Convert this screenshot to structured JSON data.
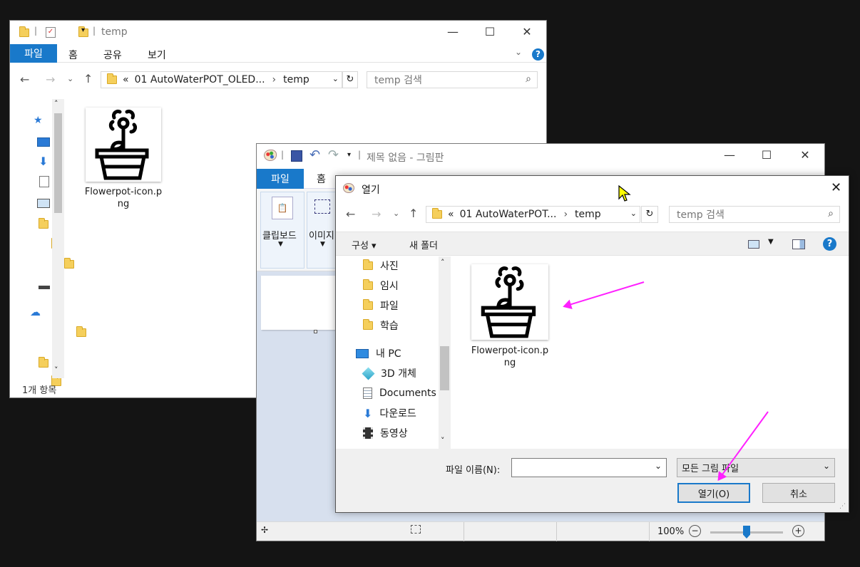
{
  "explorer": {
    "title": "temp",
    "tabs": [
      "파일",
      "홈",
      "공유",
      "보기"
    ],
    "address": {
      "prefix": "«",
      "path1": "01 AutoWaterPOT_OLED...",
      "sep": "›",
      "path2": "temp"
    },
    "search_placeholder": "temp 검색",
    "file": {
      "name_line1": "Flowerpot-icon.p",
      "name_line2": "ng"
    },
    "status": "1개 항목"
  },
  "paint": {
    "title": "제목 없음 - 그림판",
    "tabs": [
      "파일",
      "홈"
    ],
    "ribbon": {
      "clipboard": "클립보드",
      "image": "이미지"
    },
    "status": {
      "zoom": "100%"
    }
  },
  "open_dialog": {
    "title": "열기",
    "address": {
      "prefix": "«",
      "path1": "01 AutoWaterPOT...",
      "sep": "›",
      "path2": "temp"
    },
    "search_placeholder": "temp 검색",
    "toolbar": {
      "organize": "구성 ▾",
      "new_folder": "새 폴더"
    },
    "nav": [
      {
        "label": "사진",
        "icon": "folder"
      },
      {
        "label": "임시",
        "icon": "folder"
      },
      {
        "label": "파일",
        "icon": "folder"
      },
      {
        "label": "학습",
        "icon": "folder"
      },
      {
        "label": "내 PC",
        "icon": "pc"
      },
      {
        "label": "3D 개체",
        "icon": "cube"
      },
      {
        "label": "Documents",
        "icon": "document"
      },
      {
        "label": "다운로드",
        "icon": "download"
      },
      {
        "label": "동영상",
        "icon": "video"
      }
    ],
    "file": {
      "name_line1": "Flowerpot-icon.p",
      "name_line2": "ng"
    },
    "filename_label": "파일 이름(N):",
    "filename_value": "",
    "filetype": "모든 그림 파일",
    "open_button": "열기(O)",
    "cancel_button": "취소"
  },
  "colors": {
    "accent": "#1979ca",
    "annotation": "#ff20ff",
    "background": "#141414"
  }
}
